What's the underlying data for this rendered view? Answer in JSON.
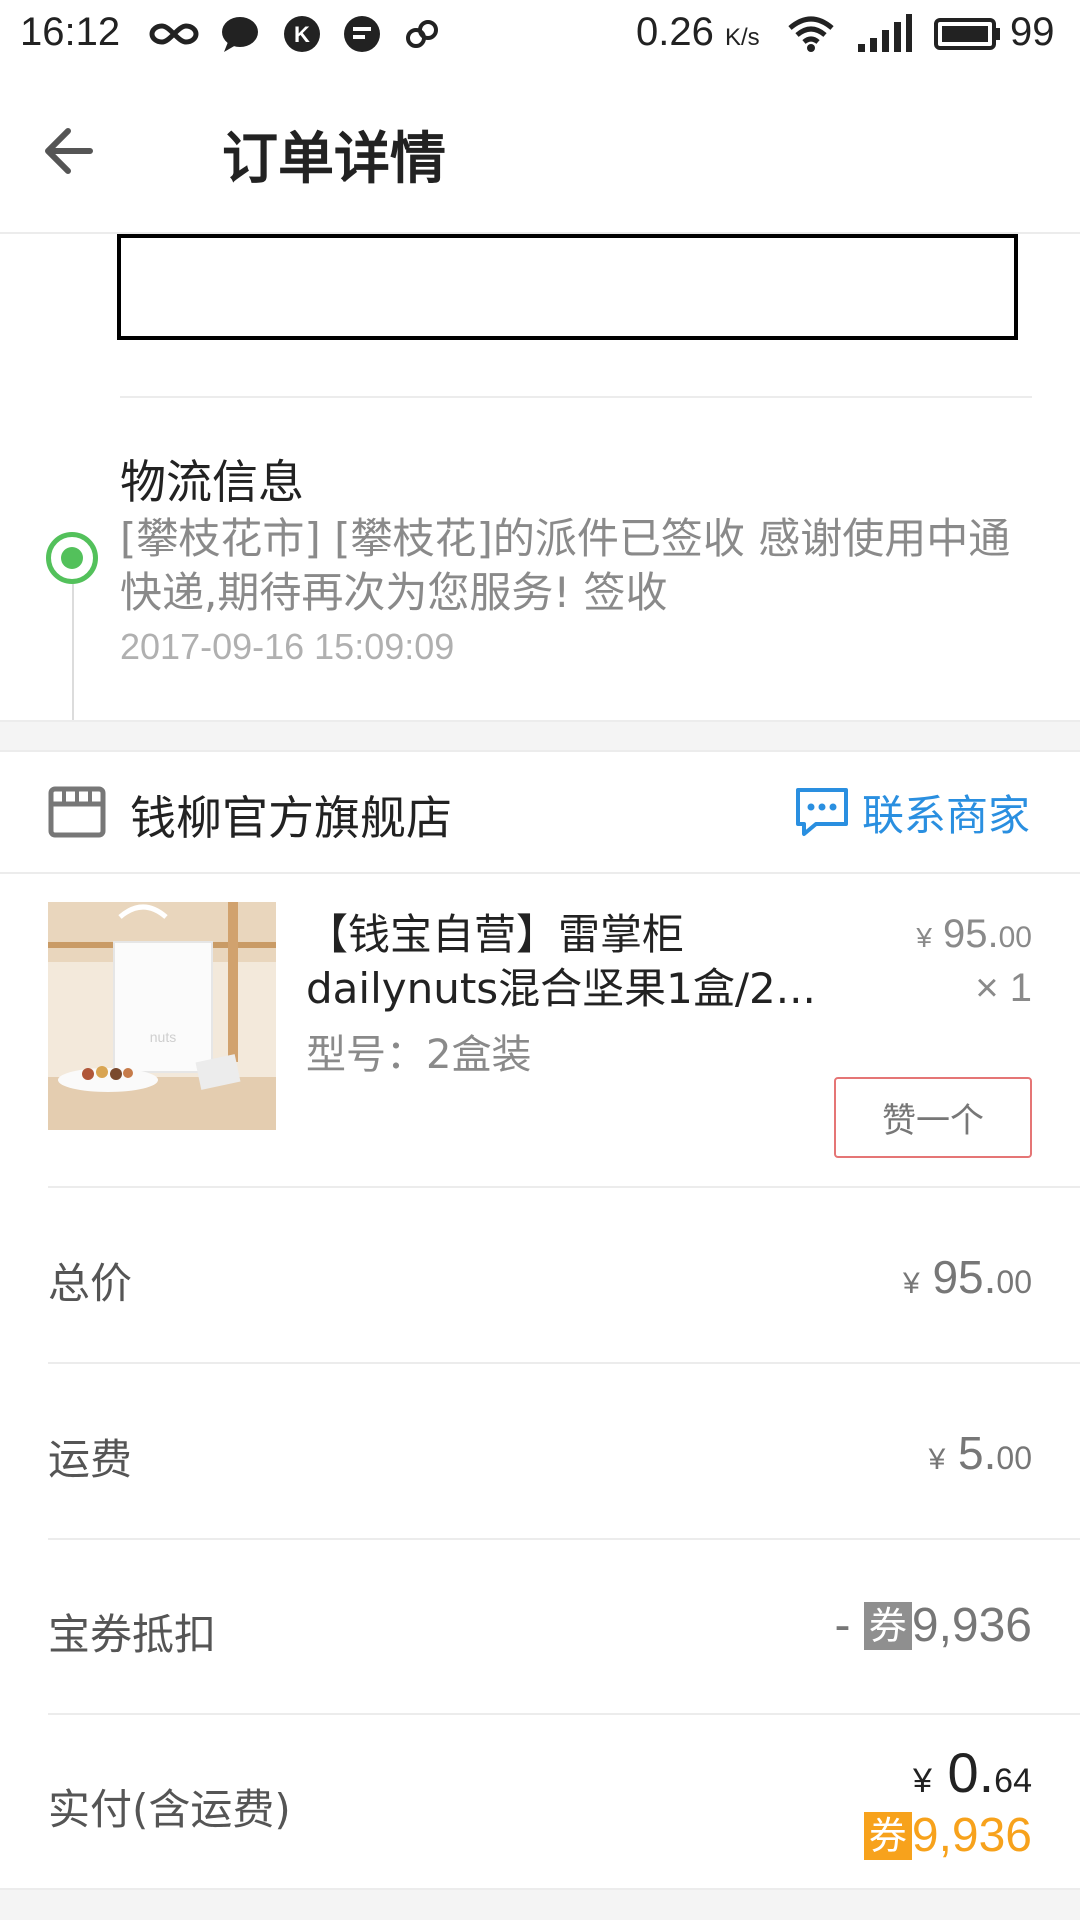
{
  "status_bar": {
    "time": "16:12",
    "net_speed": "0.26",
    "net_unit": "K/s",
    "battery": "99"
  },
  "header": {
    "title": "订单详情",
    "back_icon": "arrow-left-icon"
  },
  "logistics": {
    "title": "物流信息",
    "message": "[攀枝花市] [攀枝花]的派件已签收 感谢使用中通快递,期待再次为您服务! 签收",
    "time": "2017-09-16 15:09:09",
    "status_color": "#53c15b"
  },
  "store": {
    "name": "钱柳官方旗舰店",
    "contact_label": "联系商家",
    "accent": "#2a8fe0"
  },
  "product": {
    "title_line1": "【钱宝自营】雷掌柜",
    "title_line2": "dailynuts混合坚果1盒/2...",
    "spec": "型号：2盒装",
    "price_currency": "¥",
    "price_int": " 95.",
    "price_dec": "00",
    "qty": "× 1",
    "like_label": "赞一个"
  },
  "summary": {
    "total_label": "总价",
    "total_cur": "¥",
    "total_int": " 95.",
    "total_dec": "00",
    "shipping_label": "运费",
    "shipping_cur": "¥",
    "shipping_int": " 5.",
    "shipping_dec": "00",
    "coupon_label": "宝券抵扣",
    "coupon_prefix": "- ",
    "coupon_badge": "券",
    "coupon_value": "9,936",
    "paid_label": "实付(含运费)",
    "paid_cur": "¥",
    "paid_int": " 0.",
    "paid_dec": "64",
    "paid_coupon_badge": "券",
    "paid_coupon_value": "9,936",
    "coupon_color": "#f7a21c"
  }
}
